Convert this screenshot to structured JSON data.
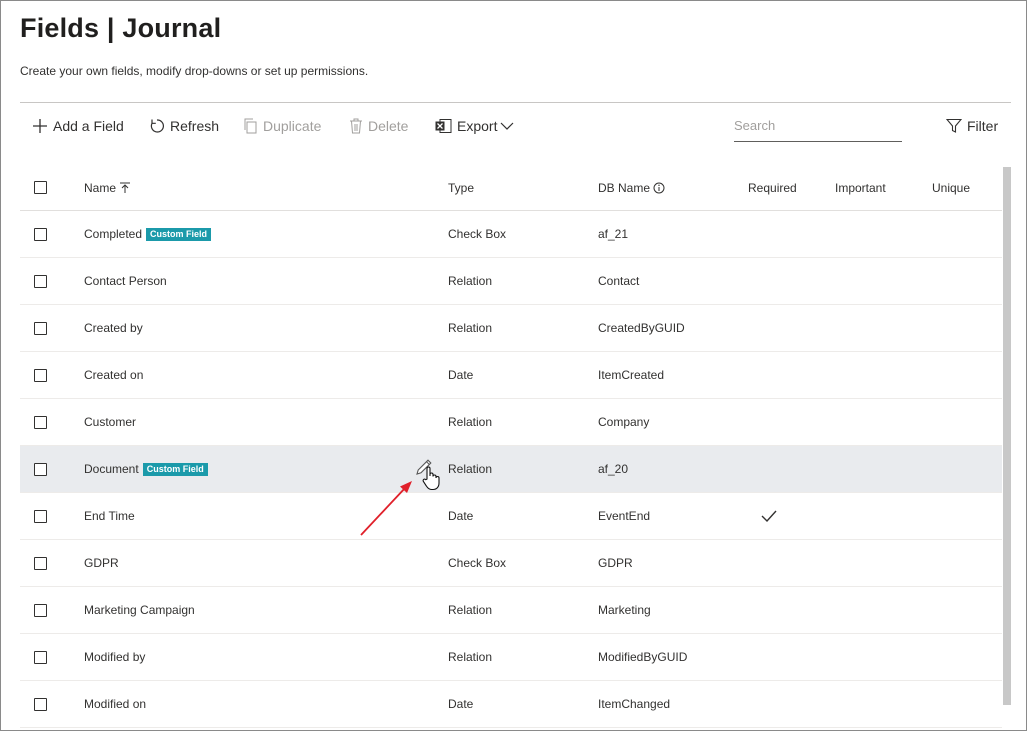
{
  "page": {
    "title": "Fields | Journal",
    "subtitle": "Create your own fields, modify drop-downs or set up permissions."
  },
  "toolbar": {
    "add_label": "Add a Field",
    "refresh_label": "Refresh",
    "duplicate_label": "Duplicate",
    "delete_label": "Delete",
    "export_label": "Export",
    "search_placeholder": "Search",
    "filter_label": "Filter"
  },
  "table": {
    "headers": {
      "name": "Name",
      "type": "Type",
      "db_name": "DB Name",
      "required": "Required",
      "important": "Important",
      "unique": "Unique"
    },
    "custom_badge": "Custom Field",
    "rows": [
      {
        "name": "Completed",
        "custom": true,
        "type": "Check Box",
        "db": "af_21",
        "required": false
      },
      {
        "name": "Contact Person",
        "custom": false,
        "type": "Relation",
        "db": "Contact",
        "required": false
      },
      {
        "name": "Created by",
        "custom": false,
        "type": "Relation",
        "db": "CreatedByGUID",
        "required": false
      },
      {
        "name": "Created on",
        "custom": false,
        "type": "Date",
        "db": "ItemCreated",
        "required": false
      },
      {
        "name": "Customer",
        "custom": false,
        "type": "Relation",
        "db": "Company",
        "required": false
      },
      {
        "name": "Document",
        "custom": true,
        "type": "Relation",
        "db": "af_20",
        "required": false,
        "hover": true
      },
      {
        "name": "End Time",
        "custom": false,
        "type": "Date",
        "db": "EventEnd",
        "required": true
      },
      {
        "name": "GDPR",
        "custom": false,
        "type": "Check Box",
        "db": "GDPR",
        "required": false
      },
      {
        "name": "Marketing Campaign",
        "custom": false,
        "type": "Relation",
        "db": "Marketing",
        "required": false
      },
      {
        "name": "Modified by",
        "custom": false,
        "type": "Relation",
        "db": "ModifiedByGUID",
        "required": false
      },
      {
        "name": "Modified on",
        "custom": false,
        "type": "Date",
        "db": "ItemChanged",
        "required": false
      }
    ]
  },
  "colors": {
    "badge": "#1b9aaa",
    "annotation_arrow": "#e0202a",
    "hover_row": "#e9ebee"
  }
}
